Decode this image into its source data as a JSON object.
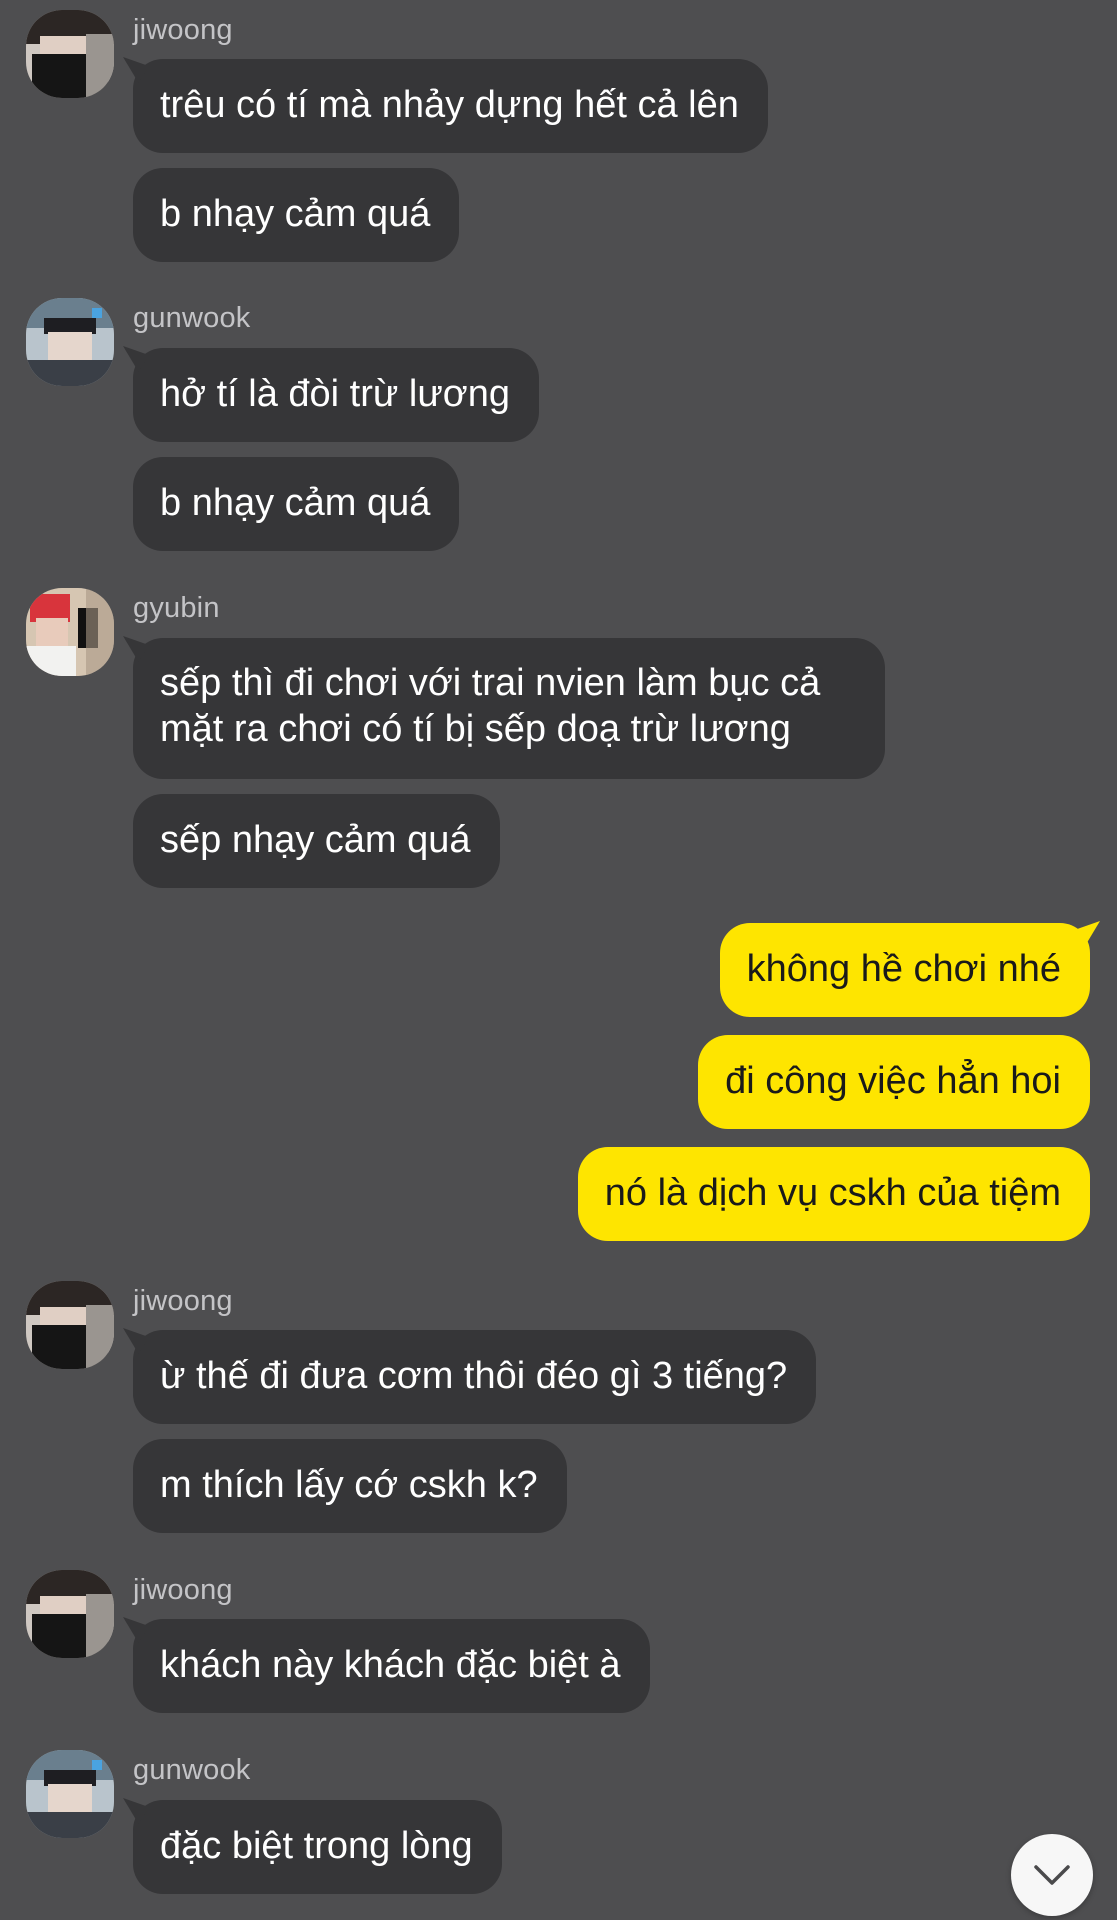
{
  "messages": {
    "g1": {
      "sender": "jiwoong",
      "texts": [
        "trêu có tí mà nhảy dựng hết cả lên",
        "b nhạy cảm quá"
      ]
    },
    "g2": {
      "sender": "gunwook",
      "texts": [
        "hở tí là đòi trừ lương",
        "b nhạy cảm quá"
      ]
    },
    "g3": {
      "sender": "gyubin",
      "texts": [
        "sếp thì đi chơi với trai nvien làm bục cả mặt ra chơi có tí bị sếp doạ trừ lương",
        "sếp nhạy cảm quá"
      ]
    },
    "mine": {
      "texts": [
        "không hề chơi nhé",
        "đi công việc hẳn hoi",
        "nó là dịch vụ cskh của tiệm"
      ]
    },
    "g4": {
      "sender": "jiwoong",
      "texts": [
        "ừ thế đi đưa cơm thôi đéo gì 3 tiếng?",
        "m thích lấy cớ cskh k?"
      ]
    },
    "g5": {
      "sender": "jiwoong",
      "texts": [
        "khách này khách đặc biệt à"
      ]
    },
    "g6": {
      "sender": "gunwook",
      "texts": [
        "đặc biệt trong lòng"
      ]
    }
  },
  "icons": {
    "scroll_down": "chevron-down-icon"
  },
  "colors": {
    "background": "#4e4e50",
    "incoming_bubble": "#363638",
    "outgoing_bubble": "#fee500",
    "sender_name": "#c4c4c7"
  }
}
